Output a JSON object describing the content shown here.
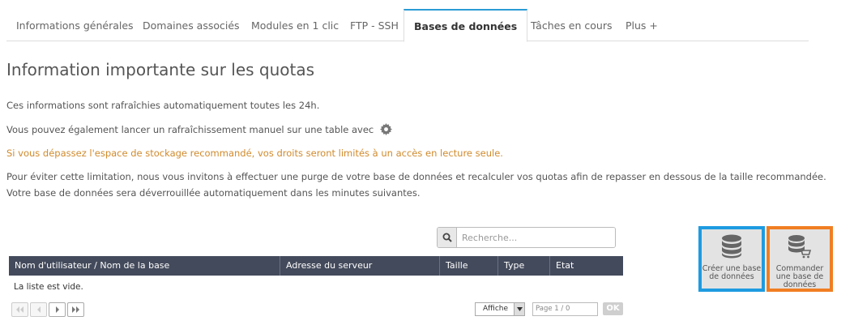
{
  "tabs": [
    {
      "label": "Informations générales"
    },
    {
      "label": "Domaines associés"
    },
    {
      "label": "Modules en 1 clic"
    },
    {
      "label": "FTP - SSH"
    },
    {
      "label": "Bases de données"
    },
    {
      "label": "Tâches en cours"
    },
    {
      "label": "Plus +"
    }
  ],
  "page": {
    "title": "Information importante sur les quotas",
    "info1": "Ces informations sont rafraîchies automatiquement toutes les 24h.",
    "info2": "Vous pouvez également lancer un rafraîchissement manuel sur une table avec",
    "warning": "Si vous dépassez l'espace de stockage recommandé, vos droits seront limités à un accès en lecture seule.",
    "info3": "Pour éviter cette limitation, nous vous invitons à effectuer une purge de votre base de données et recalculer vos quotas afin de repasser en dessous de la taille recommandée.",
    "info4": "Votre base de données sera déverrouillée automatiquement dans les minutes suivantes."
  },
  "search": {
    "placeholder": "Recherche..."
  },
  "table": {
    "columns": [
      "Nom d'utilisateur / Nom de la base",
      "Adresse du serveur",
      "Taille",
      "Type",
      "Etat"
    ],
    "empty_text": "La liste est vide."
  },
  "pagination": {
    "per_page_label": "Affiche",
    "page_input": "Page 1 / 0",
    "ok_label": "OK"
  },
  "actions": {
    "create": "Créer une base de données",
    "order": "Commander une base de données"
  },
  "colors": {
    "accent": "#2b9bd6",
    "warning": "#d08a2c",
    "table_header": "#434a5b",
    "highlight_blue": "#1e9be0",
    "highlight_orange": "#f07e22"
  },
  "icons": [
    "gear-icon",
    "search-icon",
    "database-icon",
    "database-cart-icon",
    "first-page-icon",
    "prev-page-icon",
    "next-page-icon",
    "last-page-icon",
    "dropdown-arrow-icon"
  ]
}
